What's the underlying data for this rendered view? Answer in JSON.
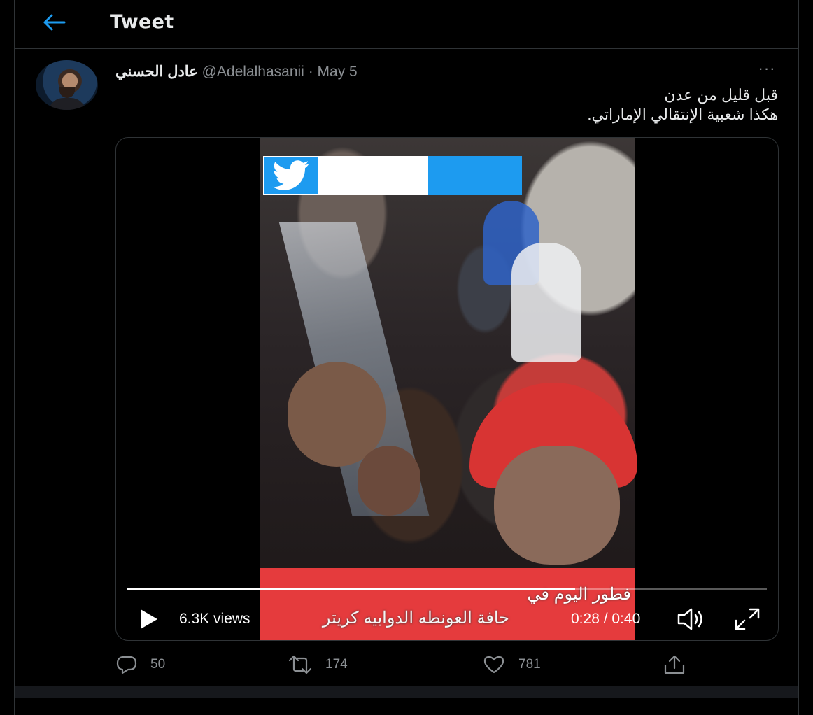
{
  "header": {
    "title": "Tweet",
    "back_icon": "arrow-left-icon"
  },
  "tweet": {
    "author_name": "عادل الحسني",
    "handle": "@Adelalhasanii",
    "separator": "·",
    "date": "May 5",
    "more_icon": "···",
    "text_line1": "قبل قليل من عدن",
    "text_line2": "هكذا شعبية الإنتقالي الإماراتي."
  },
  "video": {
    "caption_line1": "فطور اليوم في",
    "caption_line2": "حافة العونطه الدوابيه كريتر",
    "views": "6.3K views",
    "time": "0:28 / 0:40",
    "progress": 0.7,
    "play_icon": "play-icon",
    "volume_icon": "volume-icon",
    "fullscreen_icon": "fullscreen-icon"
  },
  "actions": {
    "reply_count": "50",
    "retweet_count": "174",
    "like_count": "781"
  },
  "colors": {
    "accent": "#1d9bf0",
    "background": "#000000",
    "caption_band": "#e53b3d"
  }
}
